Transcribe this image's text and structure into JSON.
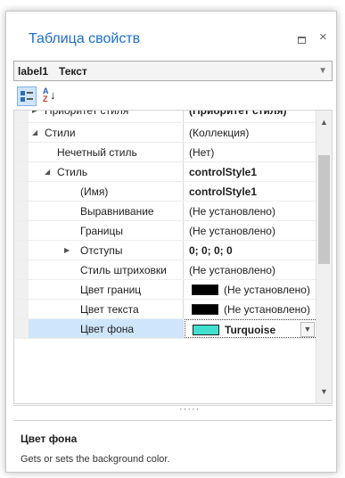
{
  "window": {
    "title": "Таблица свойств",
    "restore_icon": "restore-window-icon",
    "close_glyph": "×"
  },
  "object_selector": {
    "name": "label1",
    "type": "Текст"
  },
  "toolbar": {
    "categorized_icon": "categorized-view-icon",
    "alphabetical_icon": "sort-alphabetical-icon",
    "alpha_top": "A",
    "alpha_bottom": "Z"
  },
  "rows": [
    {
      "name": "Приоритет стиля",
      "value": "(Приоритет стиля)",
      "indent": 0,
      "expander": "▶",
      "value_bold": true
    },
    {
      "name": "Стили",
      "value": "(Коллекция)",
      "indent": 0,
      "expander": "◢"
    },
    {
      "name": "Нечетный стиль",
      "value": "(Нет)",
      "indent": 1
    },
    {
      "name": "Стиль",
      "value": "controlStyle1",
      "indent": 1,
      "expander": "◢",
      "value_bold": true
    },
    {
      "name": "(Имя)",
      "value": "controlStyle1",
      "indent": 2,
      "value_bold": true
    },
    {
      "name": "Выравнивание",
      "value": "(Не установлено)",
      "indent": 2
    },
    {
      "name": "Границы",
      "value": "(Не установлено)",
      "indent": 2
    },
    {
      "name": "Отступы",
      "value": "0; 0; 0; 0",
      "indent": 2,
      "expander": "▶",
      "value_bold": true
    },
    {
      "name": "Стиль штриховки",
      "value": "(Не установлено)",
      "indent": 2
    },
    {
      "name": "Цвет границ",
      "value": "(Не установлено)",
      "indent": 2,
      "swatch": "#000000"
    },
    {
      "name": "Цвет текста",
      "value": "(Не установлено)",
      "indent": 2,
      "swatch": "#000000"
    },
    {
      "name": "Цвет фона",
      "value": "Turquoise",
      "indent": 2,
      "swatch": "#40e0d0",
      "value_bold": true,
      "selected": true,
      "dropdown": true
    }
  ],
  "help": {
    "title": "Цвет фона",
    "description": "Gets or sets the background color."
  },
  "colors": {
    "accent": "#1e6ec8",
    "selection": "#cfe5fb",
    "turquoise": "#40e0d0"
  }
}
